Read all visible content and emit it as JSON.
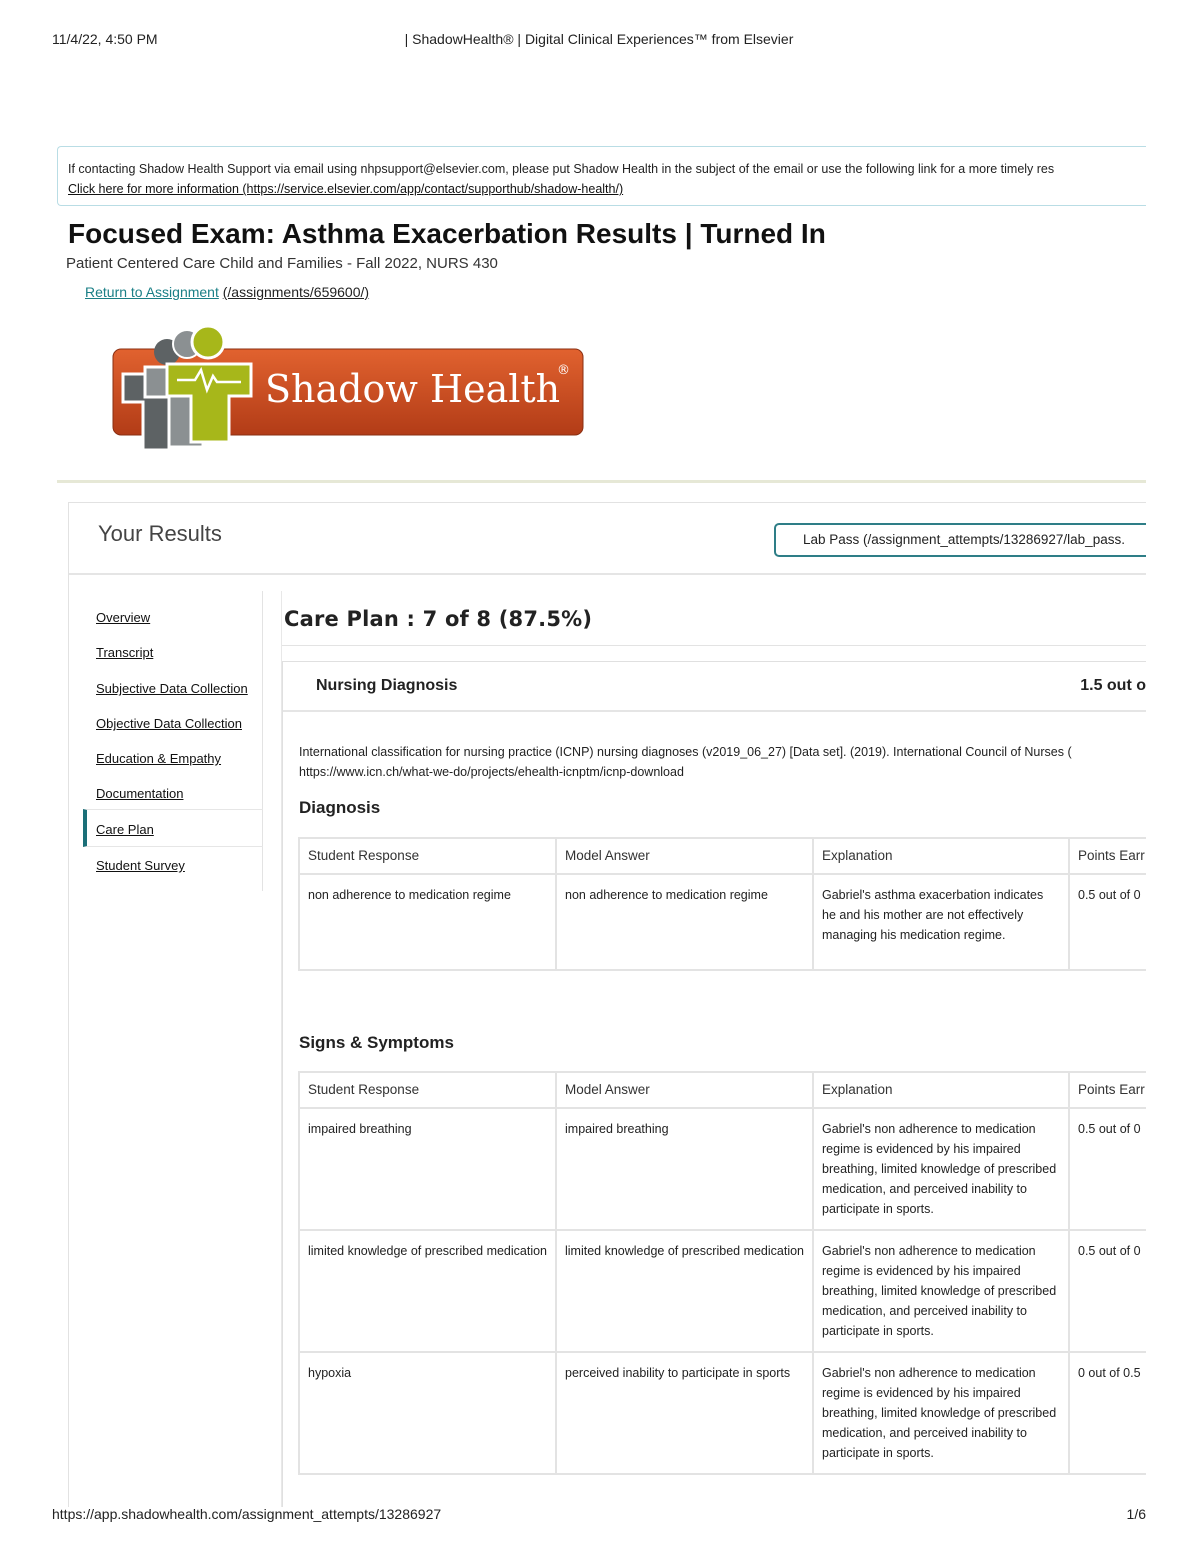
{
  "print": {
    "date": "11/4/22, 4:50 PM",
    "title": "| ShadowHealth® | Digital Clinical Experiences™ from Elsevier",
    "url": "https://app.shadowhealth.com/assignment_attempts/13286927",
    "page": "1/6"
  },
  "support": {
    "line1": "If contacting Shadow Health Support via email using nhpsupport@elsevier.com, please put Shadow Health in the subject of the email or use the following link for a more timely res",
    "link": "Click here for more information (https://service.elsevier.com/app/contact/supporthub/shadow-health/)"
  },
  "header": {
    "title": "Focused Exam: Asthma Exacerbation Results | Turned In",
    "course": "Patient Centered Care Child and Families - Fall 2022, NURS 430",
    "return_label": "Return to Assignment",
    "return_path": "(/assignments/659600/)"
  },
  "logo": {
    "text": "Shadow Health",
    "mark": "®"
  },
  "results": {
    "title": "Your Results",
    "lab_pass": "Lab Pass (/assignment_attempts/13286927/lab_pass."
  },
  "sidebar": {
    "items": [
      "Overview",
      "Transcript",
      "Subjective Data Collection",
      "Objective Data Collection",
      "Education & Empathy",
      "Documentation",
      "Care Plan",
      "Student Survey"
    ],
    "active": "Care Plan"
  },
  "care_plan": {
    "title": "Care Plan : 7 of 8 (87.5%)",
    "nursing_diagnosis": "Nursing Diagnosis",
    "points": "1.5 out o",
    "citation_1": "International classification for nursing practice (ICNP) nursing diagnoses (v2019_06_27) [Data set]. (2019). International Council of Nurses (",
    "citation_2": "https://www.icn.ch/what-we-do/projects/ehealth-icnptm/icnp-download"
  },
  "columns": [
    "Student Response",
    "Model Answer",
    "Explanation",
    "Points Earr"
  ],
  "diagnosis": {
    "title": "Diagnosis",
    "rows": [
      {
        "student": "non adherence to medication regime",
        "model": "non adherence to medication regime",
        "explanation": "Gabriel's asthma exacerbation indicates he and his mother are not effectively managing his medication regime.",
        "points": "0.5 out of 0"
      }
    ]
  },
  "signs": {
    "title": "Signs & Symptoms",
    "rows": [
      {
        "student": "impaired breathing",
        "model": "impaired breathing",
        "explanation": "Gabriel's non adherence to medication regime is evidenced by his impaired breathing, limited knowledge of prescribed medication, and perceived inability to participate in sports.",
        "points": "0.5 out of 0"
      },
      {
        "student": "limited knowledge of prescribed medication",
        "model": "limited knowledge of prescribed medication",
        "explanation": "Gabriel's non adherence to medication regime is evidenced by his impaired breathing, limited knowledge of prescribed medication, and perceived inability to participate in sports.",
        "points": "0.5 out of 0"
      },
      {
        "student": "hypoxia",
        "model": "perceived inability to participate in sports",
        "explanation": "Gabriel's non adherence to medication regime is evidenced by his impaired breathing, limited knowledge of prescribed medication, and perceived inability to participate in sports.",
        "points": "0 out of 0.5"
      }
    ]
  },
  "colors": {
    "accent": "#1b6f78",
    "logo_orange": "#c9491f",
    "logo_green": "#a7b71a",
    "logo_gray": "#5d6264"
  }
}
